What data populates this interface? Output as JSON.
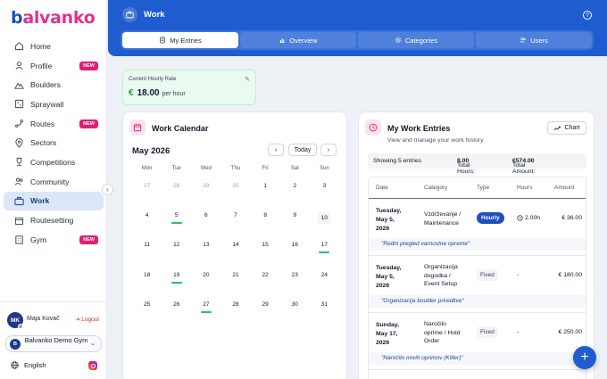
{
  "brand": {
    "part1": "b",
    "part2": "alvanko"
  },
  "sidebar": {
    "items": [
      {
        "label": "Home",
        "icon": "home-icon"
      },
      {
        "label": "Profile",
        "icon": "user-icon",
        "badge": "NEW"
      },
      {
        "label": "Boulders",
        "icon": "mountain-icon"
      },
      {
        "label": "Spraywall",
        "icon": "spraywall-icon"
      },
      {
        "label": "Routes",
        "icon": "route-icon",
        "badge": "NEW"
      },
      {
        "label": "Sectors",
        "icon": "map-pin-icon"
      },
      {
        "label": "Competitions",
        "icon": "trophy-icon"
      },
      {
        "label": "Community",
        "icon": "users-icon"
      },
      {
        "label": "Work",
        "icon": "briefcase-icon",
        "active": true
      },
      {
        "label": "Routesetting",
        "icon": "calendar-icon"
      },
      {
        "label": "Gym",
        "icon": "building-icon",
        "badge": "NEW"
      }
    ],
    "user": {
      "initials": "MK",
      "name": "Maja Kovač",
      "logout": "Logout"
    },
    "gym": {
      "initial": "B",
      "name": "Balvanko Demo Gym"
    },
    "language": "English"
  },
  "header": {
    "title": "Work",
    "tabs": [
      {
        "label": "My Entries",
        "active": true
      },
      {
        "label": "Overview"
      },
      {
        "label": "Categories"
      },
      {
        "label": "Users"
      }
    ]
  },
  "rate": {
    "label": "Current Hourly Rate",
    "currency": "€",
    "value": "18.00",
    "per": "per hour"
  },
  "calendar": {
    "title": "Work Calendar",
    "month": "May 2026",
    "today_label": "Today",
    "prev": "‹",
    "next": "›",
    "weekdays": [
      "Mon",
      "Tue",
      "Wed",
      "Thu",
      "Fri",
      "Sat",
      "Sun"
    ],
    "weeks": [
      [
        {
          "d": "27",
          "m": true
        },
        {
          "d": "28",
          "m": true
        },
        {
          "d": "29",
          "m": true
        },
        {
          "d": "30",
          "m": true
        },
        {
          "d": "1"
        },
        {
          "d": "2"
        },
        {
          "d": "3"
        }
      ],
      [
        {
          "d": "4"
        },
        {
          "d": "5",
          "mark": true
        },
        {
          "d": "6"
        },
        {
          "d": "7"
        },
        {
          "d": "8"
        },
        {
          "d": "9"
        },
        {
          "d": "10",
          "today": true
        }
      ],
      [
        {
          "d": "11"
        },
        {
          "d": "12"
        },
        {
          "d": "13"
        },
        {
          "d": "14"
        },
        {
          "d": "15"
        },
        {
          "d": "16"
        },
        {
          "d": "17",
          "mark": true
        }
      ],
      [
        {
          "d": "18"
        },
        {
          "d": "19",
          "mark": true
        },
        {
          "d": "20"
        },
        {
          "d": "21"
        },
        {
          "d": "22"
        },
        {
          "d": "23"
        },
        {
          "d": "24"
        }
      ],
      [
        {
          "d": "25"
        },
        {
          "d": "26"
        },
        {
          "d": "27",
          "mark": true
        },
        {
          "d": "28"
        },
        {
          "d": "29"
        },
        {
          "d": "30"
        },
        {
          "d": "31"
        }
      ]
    ]
  },
  "entries": {
    "title": "My Work Entries",
    "subtitle": "View and manage your work history",
    "chart_button": "Chart",
    "summary": {
      "showing": "Showing 5 entries",
      "hours_label": "Total Hours:",
      "hours": "8.00",
      "amount_label": "Total Amount:",
      "amount": "€574.00"
    },
    "columns": [
      "Date",
      "Category",
      "Type",
      "Hours",
      "Amount"
    ],
    "rows": [
      {
        "date": [
          "Tuesday,",
          "May 5,",
          "2026"
        ],
        "category": [
          "Vzdrževanje /",
          "Maintenance"
        ],
        "type": "Hourly",
        "hours": "2.00h",
        "amount": "€  36.00",
        "note": "\"Redni pregled varnostne opreme\""
      },
      {
        "date": [
          "Tuesday,",
          "May 5,",
          "2026"
        ],
        "category": [
          "Organizacija",
          "dogodka /",
          "Event Setup"
        ],
        "type": "Fixed",
        "hours": "-",
        "amount": "€  180.00",
        "note": "\"Organizacija boulder prireditve\""
      },
      {
        "date": [
          "Sunday,",
          "May 17,",
          "2026"
        ],
        "category": [
          "Naročilo",
          "oprime / Hold",
          "Order"
        ],
        "type": "Fixed",
        "hours": "-",
        "amount": "€  250.00",
        "note": "\"Naročilo novih oprimov (Kilter)\""
      }
    ]
  },
  "colors": {
    "primary": "#1f5cd0",
    "accent": "#e11d74",
    "success": "#22c55e"
  }
}
